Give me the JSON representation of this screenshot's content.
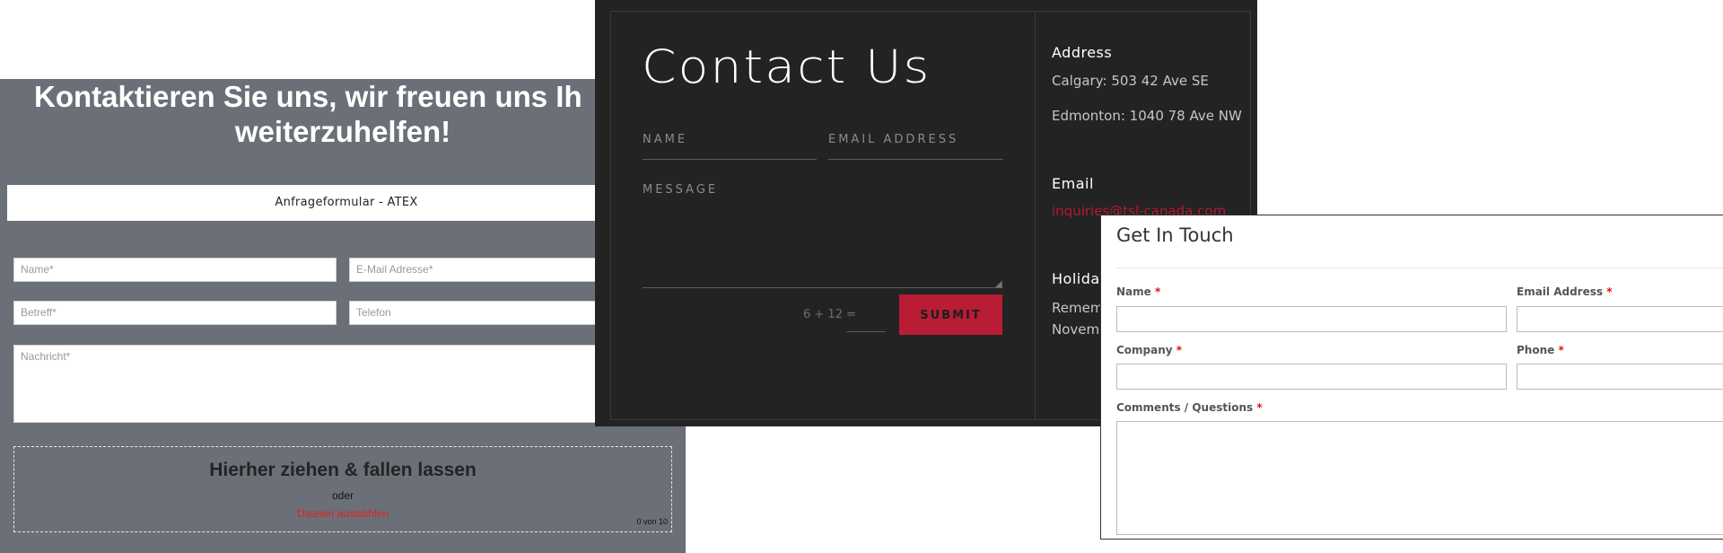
{
  "panel1": {
    "heading_line1": "Kontaktieren Sie uns, wir freuen uns Ih",
    "heading_line2": "weiterzuhelfen!",
    "form_tab_label": "Anfrageformular - ATEX",
    "fields": {
      "name_placeholder": "Name*",
      "email_placeholder": "E-Mail Adresse*",
      "subject_placeholder": "Betreff*",
      "phone_placeholder": "Telefon",
      "message_placeholder": "Nachricht*"
    },
    "dropzone": {
      "title": "Hierher ziehen & fallen lassen",
      "or": "oder",
      "select_files": "Dateien auswählen",
      "counter": "0 von 10"
    },
    "colors": {
      "background": "#6b7078",
      "link": "#e02020"
    }
  },
  "panel2": {
    "title": "Contact Us",
    "fields": {
      "name_label": "NAME",
      "email_label": "EMAIL ADDRESS",
      "message_label": "MESSAGE"
    },
    "captcha_question": "6 + 12 =",
    "submit_label": "SUBMIT",
    "address_heading": "Address",
    "address_calgary": "Calgary: 503 42 Ave SE",
    "address_edmonton": "Edmonton: 1040 78 Ave NW",
    "email_heading": "Email",
    "email_link": "inquiries@tsl-canada.com",
    "holiday_heading": "Holida",
    "holiday_line1": "Rememb",
    "holiday_line2": "Novemb",
    "colors": {
      "background": "#232324",
      "accent": "#b91c35"
    }
  },
  "panel3": {
    "title": "Get In Touch",
    "required_marker": "*",
    "labels": {
      "name": "Name",
      "email": "Email Address",
      "company": "Company",
      "phone": "Phone",
      "comments": "Comments / Questions"
    },
    "colors": {
      "required": "#dd1111"
    }
  }
}
